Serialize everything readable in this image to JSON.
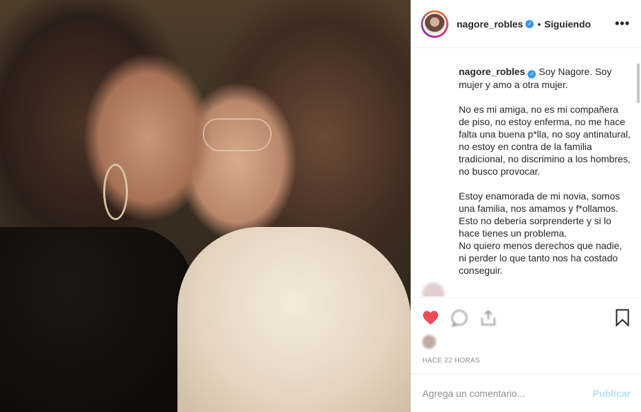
{
  "post": {
    "image_alt": "",
    "header": {
      "username": "nagore_robles",
      "separator": "•",
      "follow_status": "Siguiendo",
      "more_icon": "ellipsis-icon"
    },
    "caption": {
      "username": "nagore_robles",
      "paragraphs": [
        "Soy Nagore. Soy mujer y amo a otra mujer.",
        "No es mi amiga, no es mi compañera de piso, no estoy enferma, no me hace falta una buena p*lla, no soy antinatural, no estoy en contra de la familia tradicional, no discrimino a los hombres, no busco provocar.",
        "Estoy enamorada de mi novia, somos una familia, nos amamos y f*ollamos. Esto no debería sorprenderte y si lo hace tienes un problema.\nNo quiero menos derechos que nadie, ni perder lo que tanto nos ha costado conseguir."
      ]
    },
    "blurred_comment": "",
    "likes_lines": [
      "",
      ""
    ],
    "timestamp": "HACE 22 HORAS",
    "comment_box": {
      "placeholder": "Agrega un comentario...",
      "publish_label": "Publicar"
    },
    "colors": {
      "like_red": "#ed4956",
      "verified_blue": "#3897f0",
      "publish_disabled": "#b2dffc"
    }
  }
}
